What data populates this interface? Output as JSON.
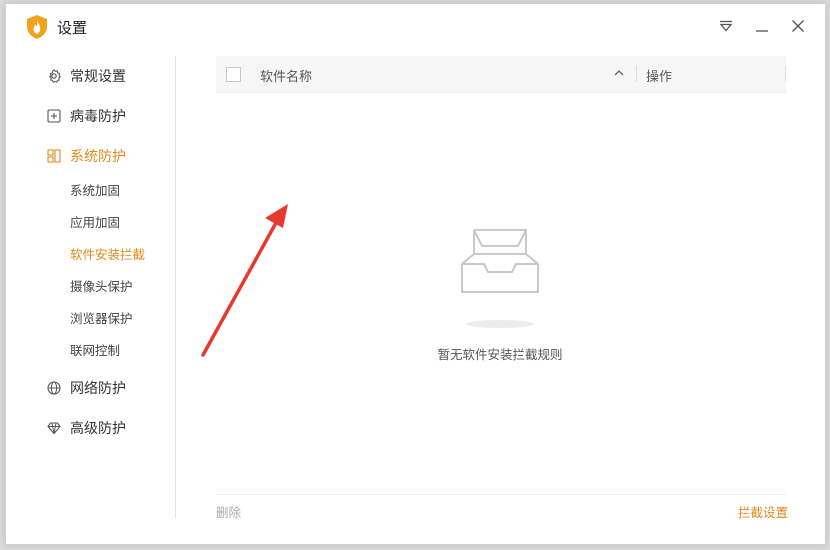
{
  "window": {
    "title": "设置"
  },
  "titlebar": {
    "icons": [
      "app-shield-logo",
      "menu-down-icon",
      "minimize-icon",
      "close-icon"
    ]
  },
  "sidebar": {
    "items": [
      {
        "label": "常规设置",
        "icon": "gear-icon"
      },
      {
        "label": "病毒防护",
        "icon": "plus-box-icon"
      },
      {
        "label": "系统防护",
        "icon": "grid-icon",
        "active": true
      },
      {
        "label": "网络防护",
        "icon": "globe-icon"
      },
      {
        "label": "高级防护",
        "icon": "diamond-icon"
      }
    ],
    "sub_items": [
      {
        "label": "系统加固"
      },
      {
        "label": "应用加固"
      },
      {
        "label": "软件安装拦截",
        "active": true
      },
      {
        "label": "摄像头保护"
      },
      {
        "label": "浏览器保护"
      },
      {
        "label": "联网控制"
      }
    ]
  },
  "table": {
    "columns": {
      "name": "软件名称",
      "action": "操作"
    },
    "empty_text": "暂无软件安装拦截规则"
  },
  "footer": {
    "delete_label": "删除",
    "settings_label": "拦截设置"
  },
  "colors": {
    "accent": "#e08a1e",
    "annotation_arrow": "#e8392f"
  }
}
